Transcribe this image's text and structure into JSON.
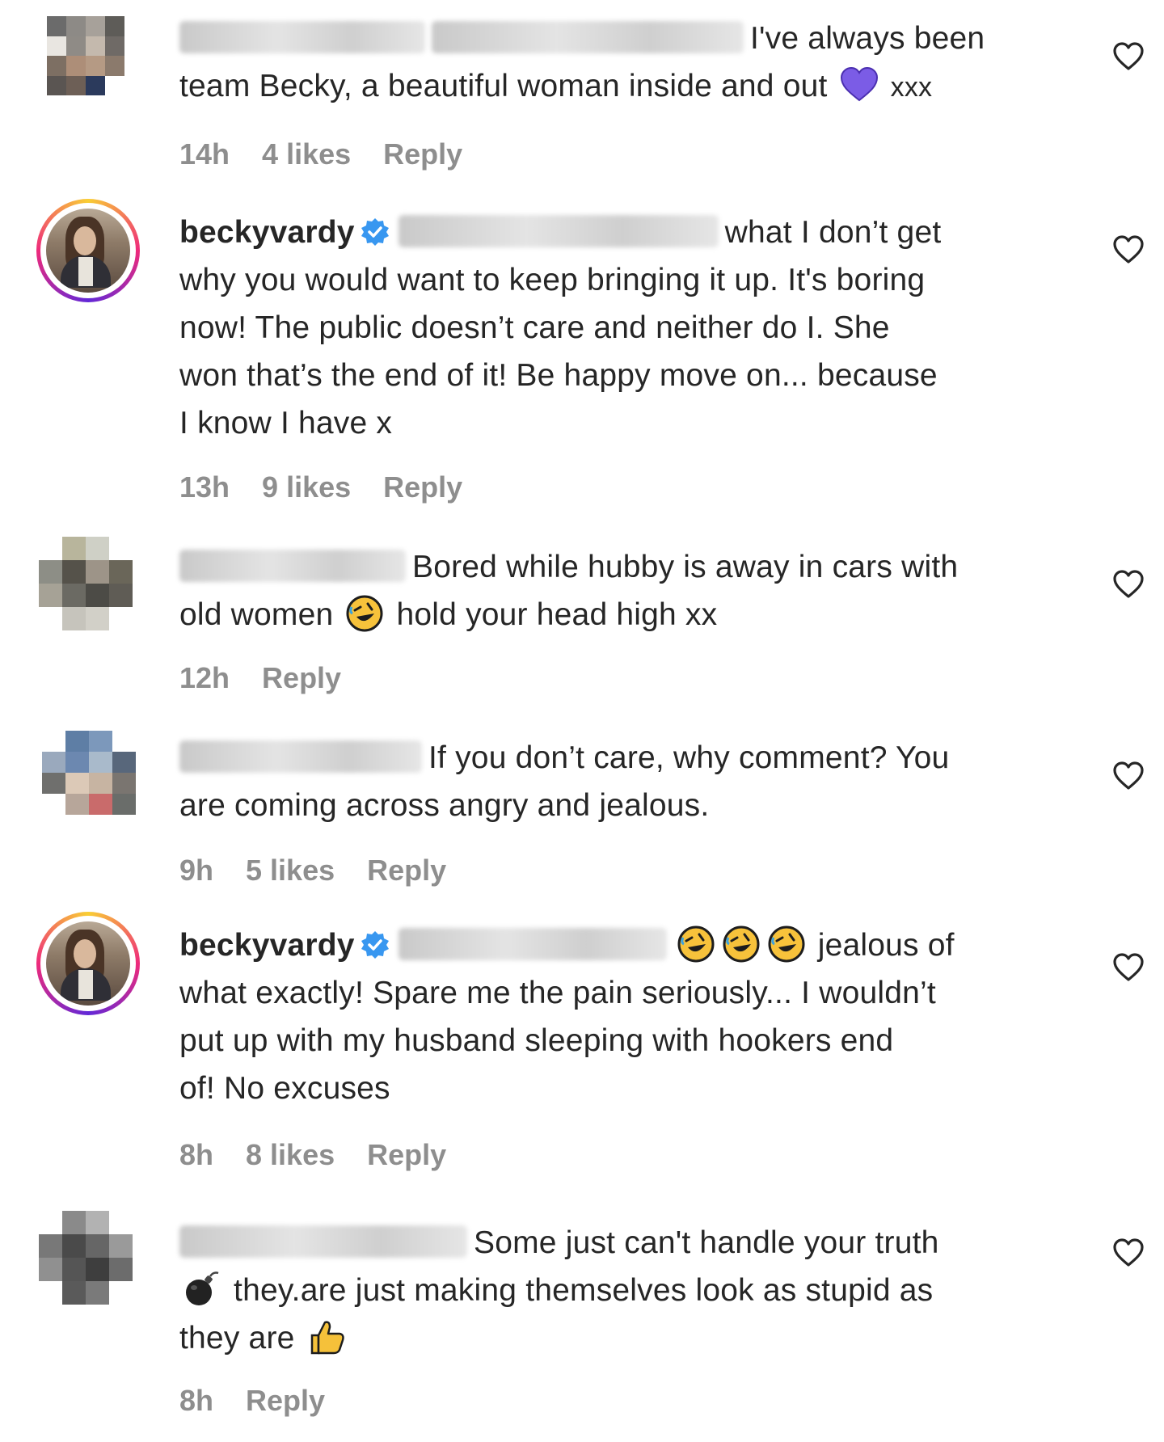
{
  "comments": [
    {
      "username": "",
      "text_lines": [
        "I've always been",
        "team Becky, a beautiful woman inside and out",
        "xxx"
      ],
      "time": "14h",
      "likes": "4 likes",
      "reply": "Reply",
      "icons": [
        "purple-heart-emoji"
      ]
    },
    {
      "username": "beckyvardy",
      "verified": true,
      "text_lines": [
        "what I don’t get",
        "why you would want to keep bringing it up. It's boring",
        "now! The public doesn’t care and neither do I. She",
        "won that’s the end of it! Be happy move on... because",
        "I know I have x"
      ],
      "time": "13h",
      "likes": "9 likes",
      "reply": "Reply"
    },
    {
      "username": "",
      "text_lines": [
        "Bored while hubby is away in cars with",
        "old women",
        "hold your head high xx"
      ],
      "time": "12h",
      "reply": "Reply",
      "icons": [
        "rolling-laughing-emoji"
      ]
    },
    {
      "username": "",
      "text_lines": [
        "If you don’t care, why comment? You",
        "are coming across angry and jealous."
      ],
      "time": "9h",
      "likes": "5 likes",
      "reply": "Reply"
    },
    {
      "username": "beckyvardy",
      "verified": true,
      "text_lines": [
        "jealous of",
        "what exactly! Spare me the pain seriously... I wouldn’t",
        "put up with my husband sleeping with hookers end",
        "of! No excuses"
      ],
      "time": "8h",
      "likes": "8 likes",
      "reply": "Reply",
      "icons": [
        "rolling-laughing-emoji",
        "rolling-laughing-emoji",
        "rolling-laughing-emoji"
      ]
    },
    {
      "username": "",
      "text_lines": [
        "Some just can't handle your truth",
        "they.are just making themselves look as stupid as",
        "they are"
      ],
      "time": "8h",
      "reply": "Reply",
      "icons": [
        "bomb-emoji",
        "thumbs-up-emoji"
      ]
    }
  ],
  "icons": {
    "like": "heart-outline-icon",
    "verified": "verified-badge-icon"
  },
  "colors": {
    "text": "#262626",
    "meta": "#8e8e8e",
    "verified": "#3897f0"
  }
}
